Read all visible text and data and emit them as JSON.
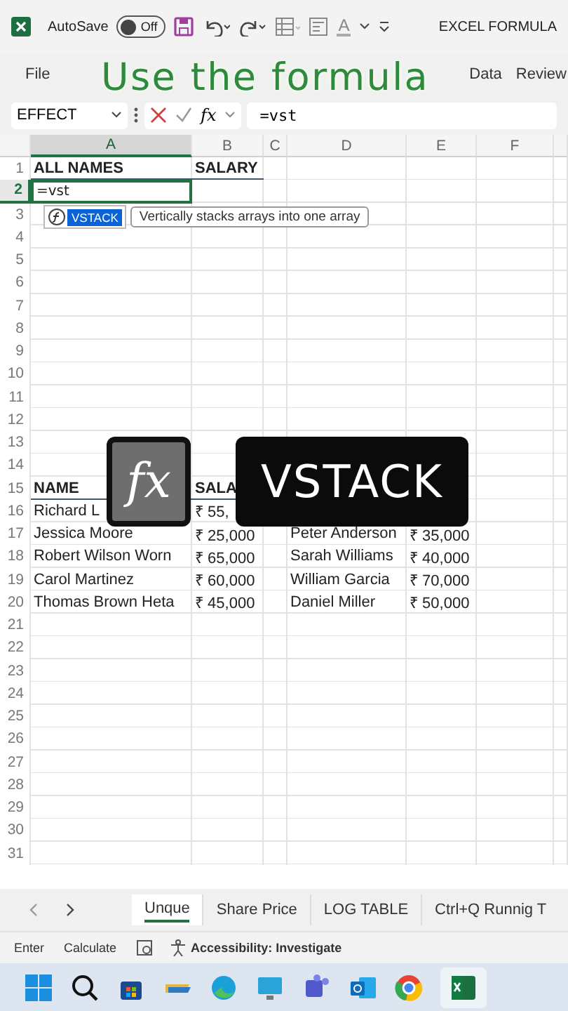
{
  "title_bar": {
    "autosave_label": "AutoSave",
    "autosave_toggle": {
      "label": "Off",
      "on": false
    },
    "font_color_letter": "A",
    "document_title": "EXCEL FORMULA"
  },
  "ribbon_tabs": [
    {
      "label": "File"
    },
    {
      "label": "Data"
    },
    {
      "label": "Review"
    }
  ],
  "caption": "Use the formula",
  "formula_bar": {
    "name_box": "EFFECT",
    "function_label": "fx",
    "value": "=vst"
  },
  "grid": {
    "columns": [
      {
        "label": "A",
        "selected": true
      },
      {
        "label": "B",
        "selected": false
      },
      {
        "label": "C",
        "selected": false
      },
      {
        "label": "D",
        "selected": false
      },
      {
        "label": "E",
        "selected": false
      },
      {
        "label": "F",
        "selected": false
      }
    ],
    "rows": [
      {
        "number": "1",
        "selected": false,
        "kind": "header",
        "cells": [
          "ALL NAMES",
          "SALARY"
        ]
      },
      {
        "number": "2",
        "selected": true,
        "kind": "data",
        "cells": [
          {
            "text": "=vst",
            "editing": true
          }
        ]
      },
      {
        "number": "3",
        "selected": false,
        "kind": "data",
        "cells": []
      },
      {
        "number": "4",
        "selected": false,
        "kind": "data",
        "cells": []
      },
      {
        "number": "5",
        "selected": false,
        "kind": "data",
        "cells": []
      },
      {
        "number": "6",
        "selected": false,
        "kind": "data",
        "cells": []
      },
      {
        "number": "7",
        "selected": false,
        "kind": "data",
        "cells": []
      },
      {
        "number": "8",
        "selected": false,
        "kind": "data",
        "cells": []
      },
      {
        "number": "9",
        "selected": false,
        "kind": "data",
        "cells": []
      },
      {
        "number": "10",
        "selected": false,
        "kind": "data",
        "cells": []
      },
      {
        "number": "11",
        "selected": false,
        "kind": "data",
        "cells": []
      },
      {
        "number": "12",
        "selected": false,
        "kind": "data",
        "cells": []
      },
      {
        "number": "13",
        "selected": false,
        "kind": "data",
        "cells": []
      },
      {
        "number": "14",
        "selected": false,
        "kind": "data",
        "cells": []
      },
      {
        "number": "15",
        "selected": false,
        "kind": "header",
        "cells": [
          "NAME",
          "SALA"
        ]
      },
      {
        "number": "16",
        "selected": false,
        "kind": "data",
        "cells": [
          "Richard L",
          "₹ 55,"
        ]
      },
      {
        "number": "17",
        "selected": false,
        "kind": "data",
        "cells": [
          "Jessica Moore",
          "₹ 25,000",
          "",
          "Peter Anderson",
          "₹ 35,000"
        ]
      },
      {
        "number": "18",
        "selected": false,
        "kind": "data",
        "cells": [
          "Robert Wilson Worn",
          "₹ 65,000",
          "",
          "Sarah Williams",
          "₹ 40,000"
        ]
      },
      {
        "number": "19",
        "selected": false,
        "kind": "data",
        "cells": [
          "Carol Martinez",
          "₹ 60,000",
          "",
          "William Garcia",
          "₹ 70,000"
        ]
      },
      {
        "number": "20",
        "selected": false,
        "kind": "data",
        "cells": [
          "Thomas Brown Heta",
          "₹ 45,000",
          "",
          "Daniel Miller",
          "₹ 50,000"
        ]
      },
      {
        "number": "21",
        "selected": false,
        "kind": "data",
        "cells": []
      },
      {
        "number": "22",
        "selected": false,
        "kind": "data",
        "cells": []
      },
      {
        "number": "23",
        "selected": false,
        "kind": "data",
        "cells": []
      },
      {
        "number": "24",
        "selected": false,
        "kind": "data",
        "cells": []
      },
      {
        "number": "25",
        "selected": false,
        "kind": "data",
        "cells": []
      },
      {
        "number": "26",
        "selected": false,
        "kind": "data",
        "cells": []
      },
      {
        "number": "27",
        "selected": false,
        "kind": "data",
        "cells": []
      },
      {
        "number": "28",
        "selected": false,
        "kind": "data",
        "cells": []
      },
      {
        "number": "29",
        "selected": false,
        "kind": "data",
        "cells": []
      },
      {
        "number": "30",
        "selected": false,
        "kind": "data",
        "cells": []
      },
      {
        "number": "31",
        "selected": false,
        "kind": "data",
        "cells": []
      }
    ]
  },
  "autocomplete": {
    "function_name": "VSTACK",
    "tooltip": "Vertically stacks arrays into one array"
  },
  "overlay_tiles": {
    "function_symbol": "fx",
    "function_name": "VSTACK"
  },
  "sheet_tabs": [
    {
      "label": "Unque",
      "selected": true
    },
    {
      "label": "Share Price",
      "selected": false
    },
    {
      "label": "LOG TABLE",
      "selected": false
    },
    {
      "label": "Ctrl+Q Runnig T",
      "selected": false
    }
  ],
  "status_bar": {
    "items": [
      "Enter",
      "Calculate"
    ],
    "accessibility": "Accessibility: Investigate"
  },
  "taskbar": {
    "spreadsheet_active": true
  }
}
